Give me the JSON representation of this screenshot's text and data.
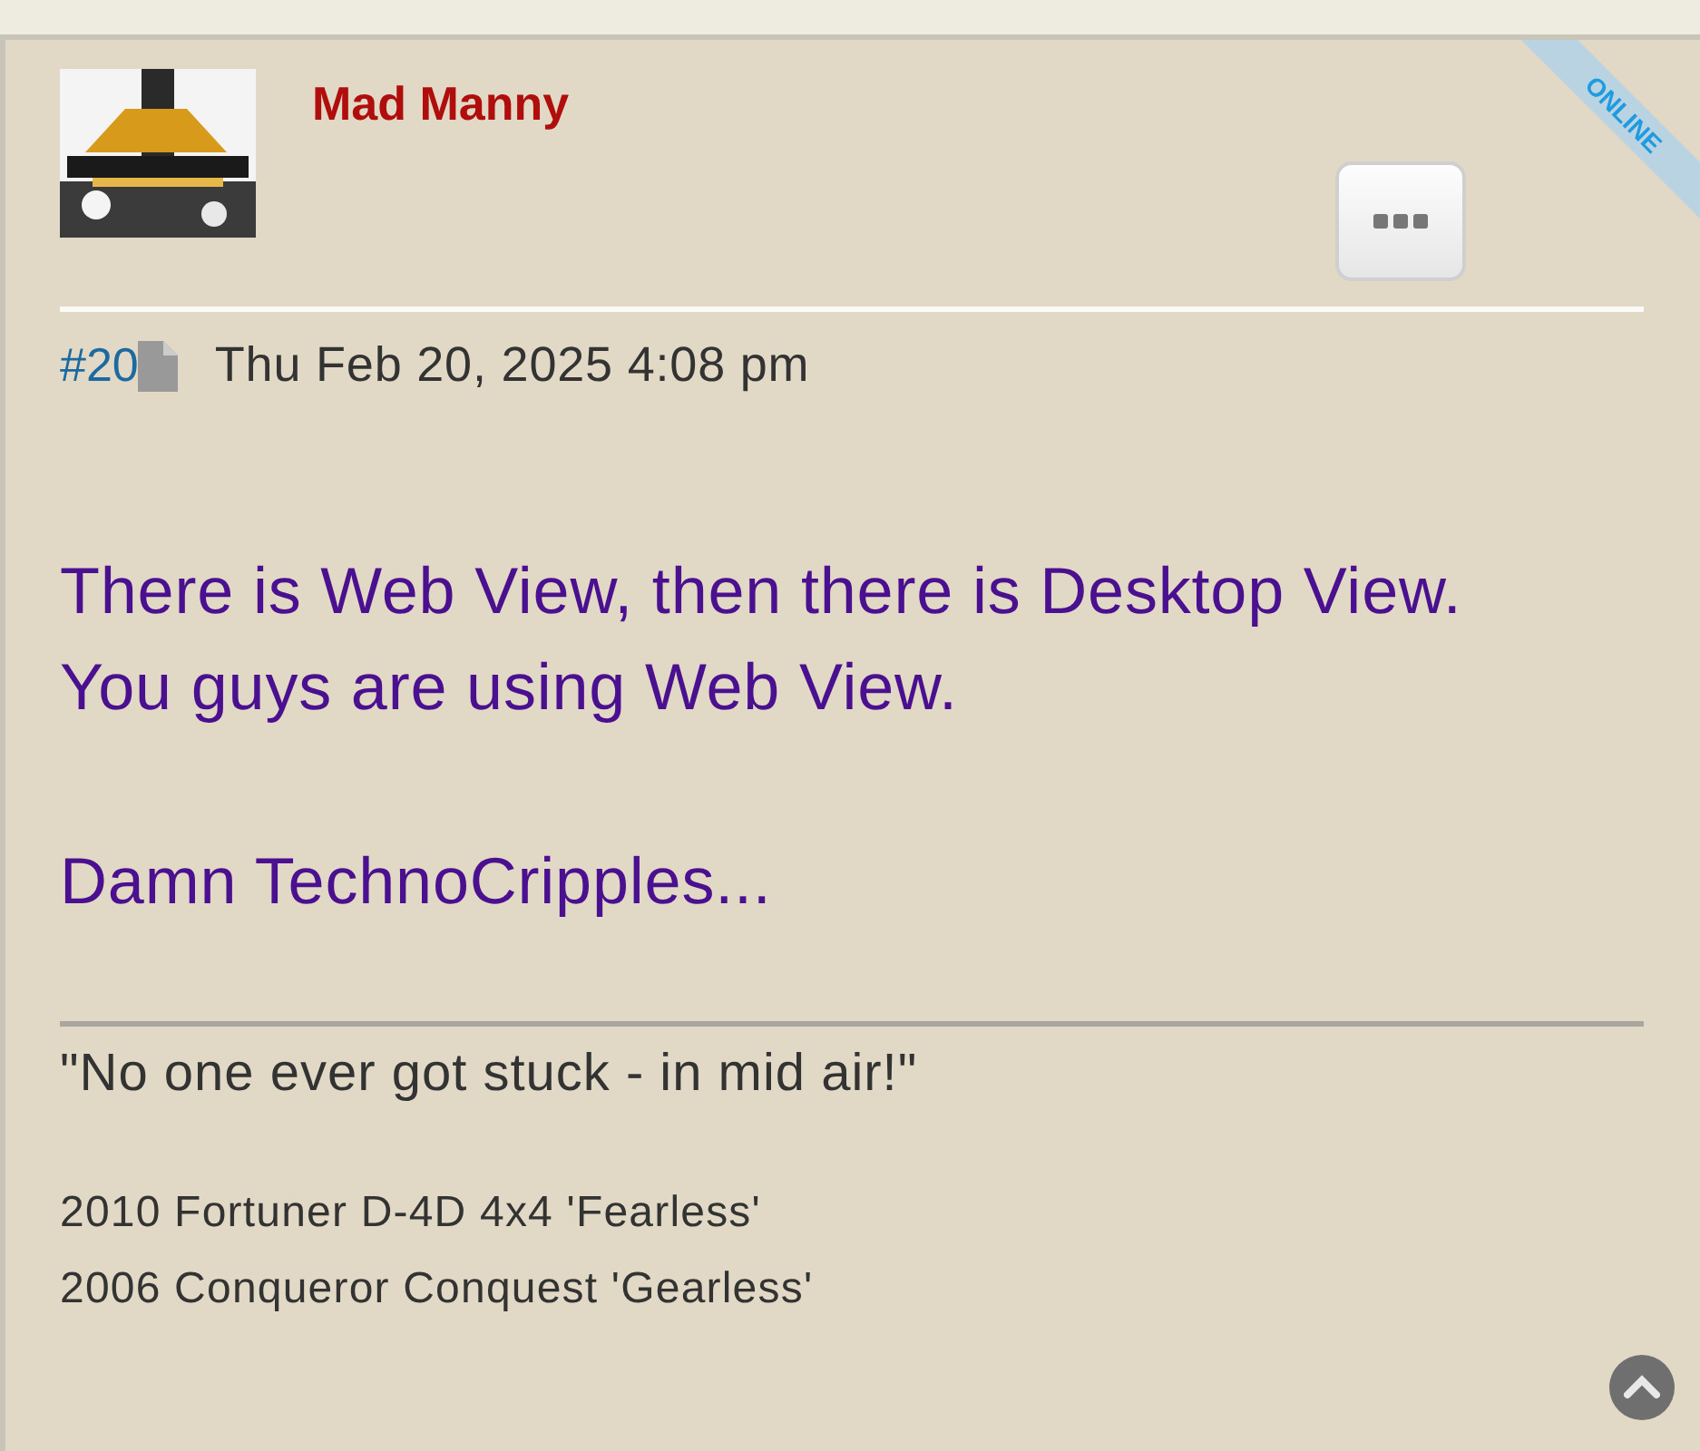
{
  "post": {
    "author": "Mad Manny",
    "status_ribbon": "ONLINE",
    "number": "#20",
    "date": "Thu Feb 20, 2025 4:08 pm",
    "avatar": {
      "kind": "picture"
    },
    "content": [
      [
        "There is Web View, then there is Desktop View.",
        "You guys are using Web View."
      ],
      [
        "Damn TechnoCripples..."
      ]
    ],
    "signature": {
      "quote": "\"No one ever got stuck - in mid air!\"",
      "lines": [
        "2010 Fortuner D-4D 4x4 'Fearless'",
        "2006 Conqueror Conquest 'Gearless'"
      ]
    }
  }
}
